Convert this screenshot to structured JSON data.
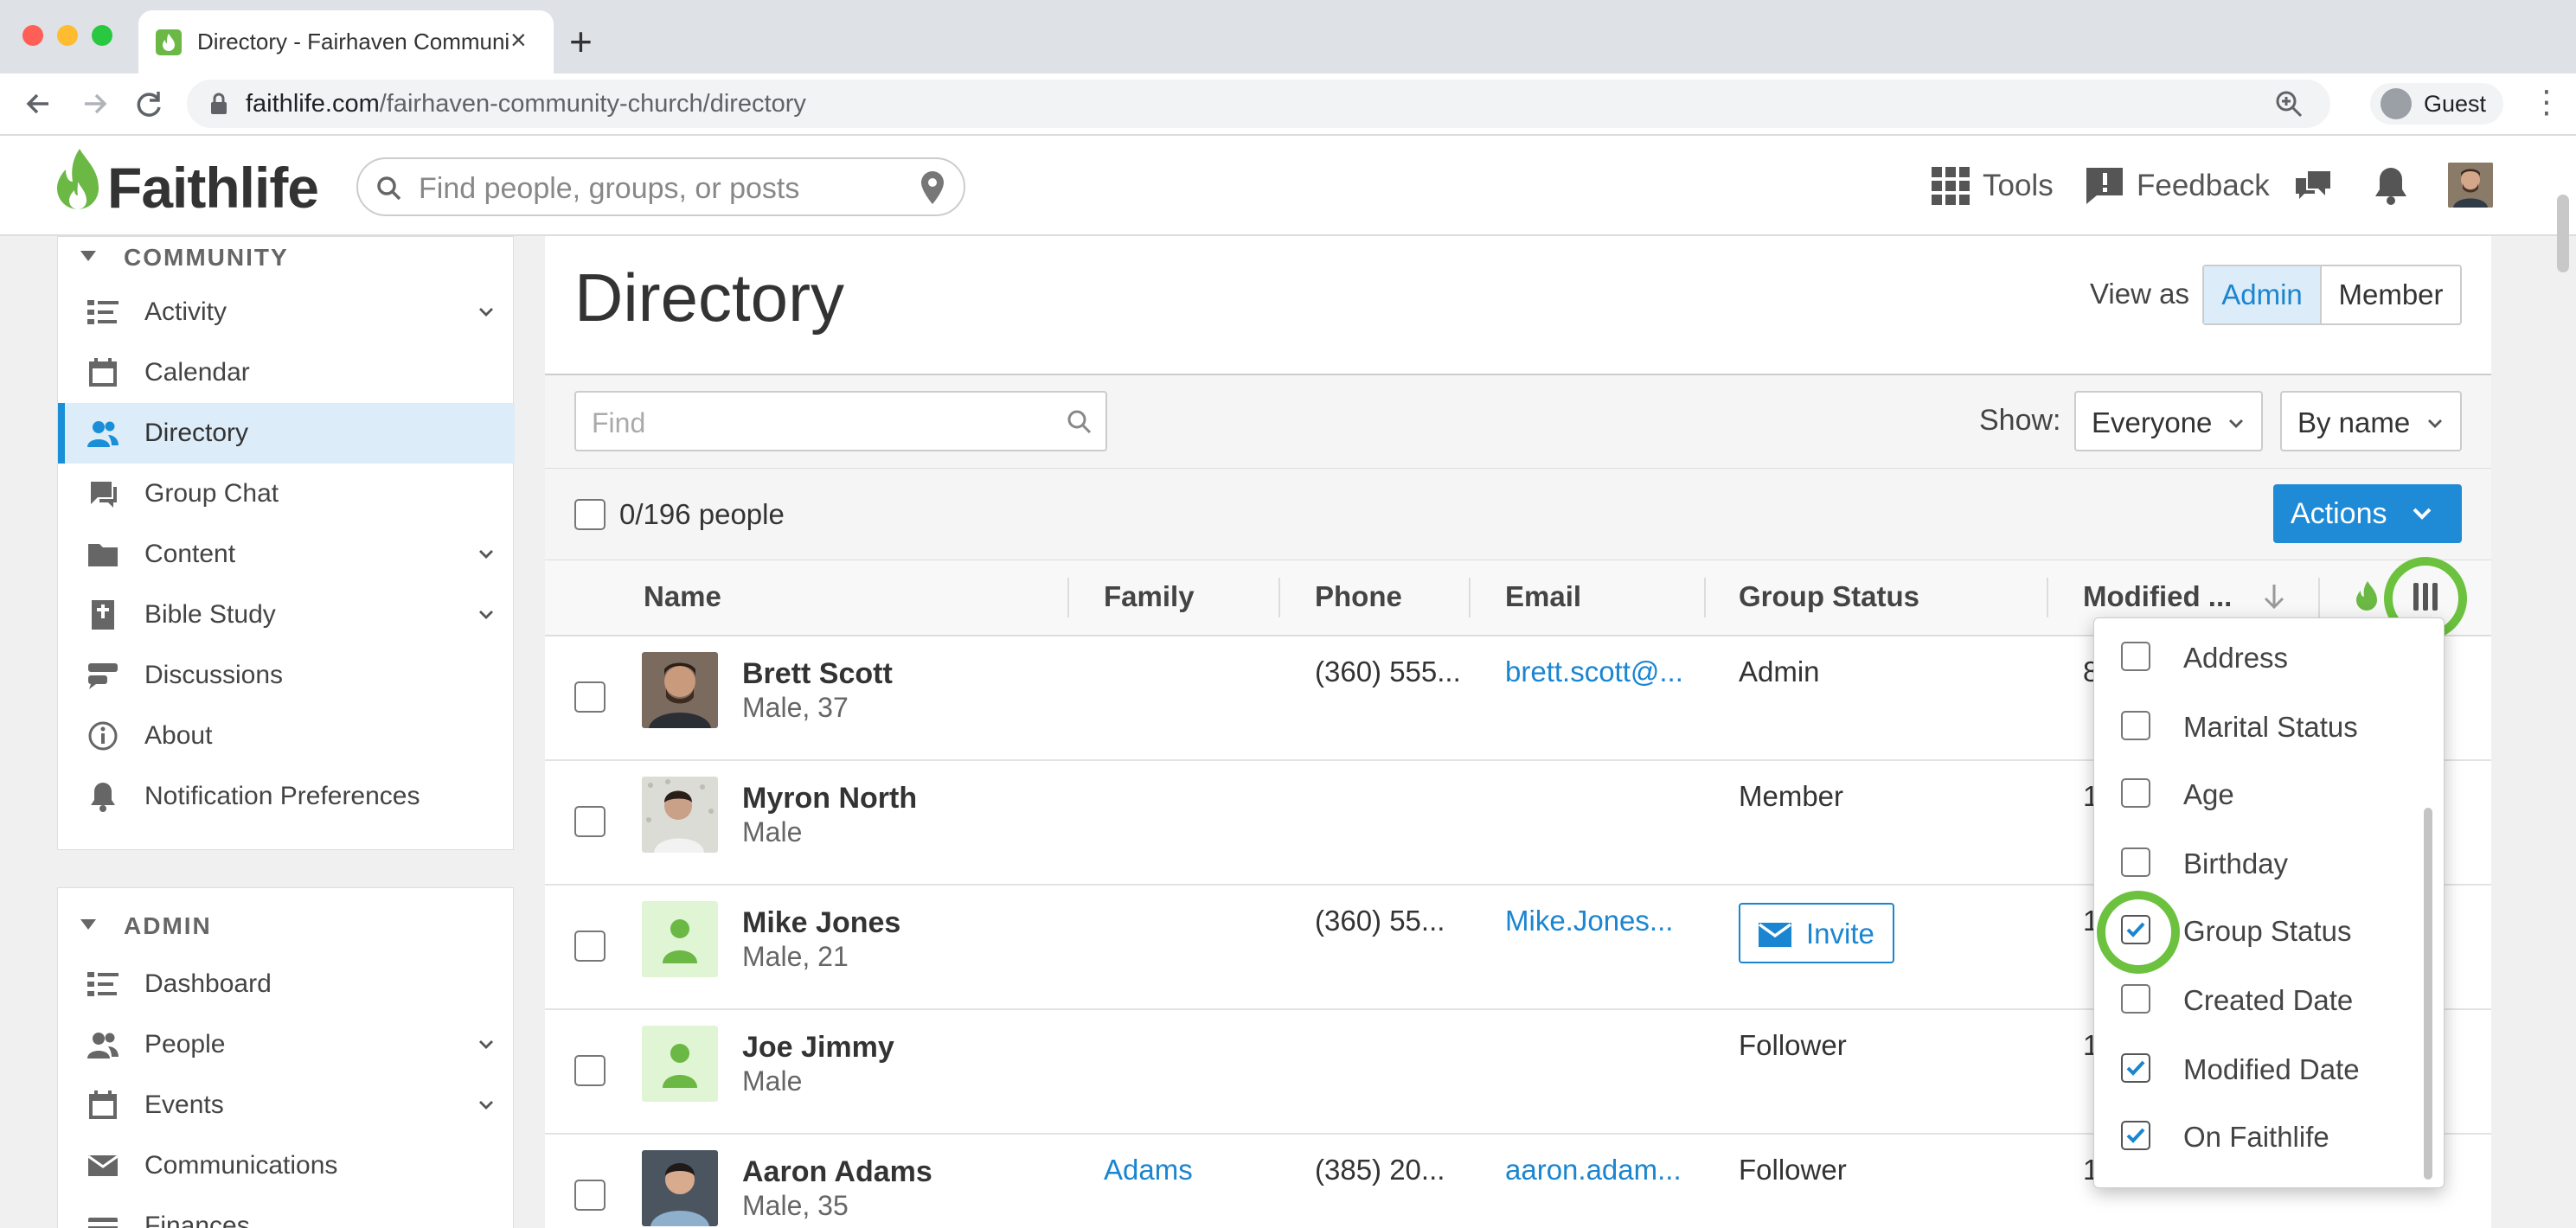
{
  "browser": {
    "tab_title": "Directory - Fairhaven Community Church",
    "tab_close": "×",
    "new_tab": "+",
    "url_host": "faithlife.com",
    "url_path": "/fairhaven-community-church/directory",
    "profile_label": "Guest"
  },
  "header": {
    "logo_text": "Faithlife",
    "search_placeholder": "Find people, groups, or posts",
    "tools_label": "Tools",
    "feedback_label": "Feedback",
    "brand_color": "#6bb844"
  },
  "sidebar": {
    "community_title": "COMMUNITY",
    "community_items": [
      {
        "label": "Activity",
        "icon": "activity-icon",
        "expandable": true
      },
      {
        "label": "Calendar",
        "icon": "calendar-icon",
        "expandable": false
      },
      {
        "label": "Directory",
        "icon": "people-icon",
        "expandable": false,
        "active": true
      },
      {
        "label": "Group Chat",
        "icon": "chat-icon",
        "expandable": false
      },
      {
        "label": "Content",
        "icon": "folder-icon",
        "expandable": true
      },
      {
        "label": "Bible Study",
        "icon": "bible-icon",
        "expandable": true
      },
      {
        "label": "Discussions",
        "icon": "discussions-icon",
        "expandable": false
      },
      {
        "label": "About",
        "icon": "info-icon",
        "expandable": false
      },
      {
        "label": "Notification Preferences",
        "icon": "bell-icon",
        "expandable": false
      }
    ],
    "admin_title": "ADMIN",
    "admin_items": [
      {
        "label": "Dashboard",
        "icon": "dashboard-icon",
        "expandable": false
      },
      {
        "label": "People",
        "icon": "people-icon",
        "expandable": true
      },
      {
        "label": "Events",
        "icon": "calendar-icon",
        "expandable": true
      },
      {
        "label": "Communications",
        "icon": "mail-icon",
        "expandable": false
      },
      {
        "label": "Finances",
        "icon": "finances-icon",
        "expandable": false
      }
    ]
  },
  "main": {
    "title": "Directory",
    "view_as_label": "View as",
    "view_as_options": [
      "Admin",
      "Member"
    ],
    "view_as_selected": "Admin",
    "find_placeholder": "Find",
    "show_label": "Show:",
    "show_value": "Everyone",
    "sort_value": "By name",
    "count_label": "0/196 people",
    "actions_label": "Actions"
  },
  "table": {
    "columns": [
      "Name",
      "Family",
      "Phone",
      "Email",
      "Group Status",
      "Modified ..."
    ],
    "rows": [
      {
        "name": "Brett Scott",
        "sub": "Male, 37",
        "family": "",
        "phone": "(360) 555...",
        "email": "brett.scott@...",
        "status": "Admin",
        "modified": "8",
        "invite": false,
        "avatar": "photo"
      },
      {
        "name": "Myron North",
        "sub": "Male",
        "family": "",
        "phone": "",
        "email": "",
        "status": "Member",
        "modified": "1",
        "invite": false,
        "avatar": "photo"
      },
      {
        "name": "Mike Jones",
        "sub": "Male, 21",
        "family": "",
        "phone": "(360) 55...",
        "email": "Mike.Jones...",
        "status": "",
        "modified": "1",
        "invite": true,
        "invite_label": "Invite",
        "avatar": "placeholder"
      },
      {
        "name": "Joe Jimmy",
        "sub": "Male",
        "family": "",
        "phone": "",
        "email": "",
        "status": "Follower",
        "modified": "1",
        "invite": false,
        "avatar": "placeholder"
      },
      {
        "name": "Aaron Adams",
        "sub": "Male, 35",
        "family": "Adams",
        "phone": "(385) 20...",
        "email": "aaron.adam...",
        "status": "Follower",
        "modified": "1",
        "invite": false,
        "avatar": "photo"
      }
    ]
  },
  "column_picker": {
    "options": [
      {
        "label": "Address",
        "checked": false
      },
      {
        "label": "Marital Status",
        "checked": false
      },
      {
        "label": "Age",
        "checked": false
      },
      {
        "label": "Birthday",
        "checked": false
      },
      {
        "label": "Group Status",
        "checked": true
      },
      {
        "label": "Created Date",
        "checked": false
      },
      {
        "label": "Modified Date",
        "checked": true
      },
      {
        "label": "On Faithlife",
        "checked": true
      }
    ],
    "highlight_color": "#6cc23e"
  }
}
